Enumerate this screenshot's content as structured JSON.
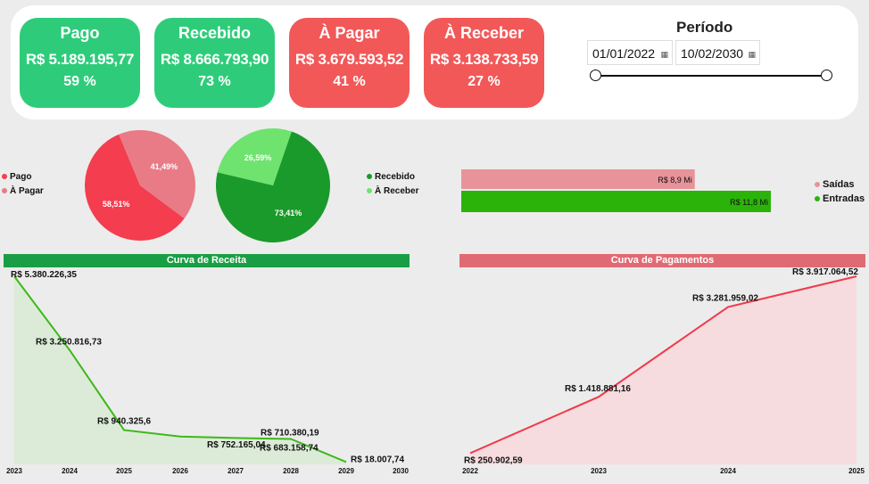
{
  "cards": [
    {
      "title": "Pago",
      "value": "R$ 5.189.195,77",
      "pct": "59 %",
      "color": "#2ecc7a"
    },
    {
      "title": "Recebido",
      "value": "R$ 8.666.793,90",
      "pct": "73 %",
      "color": "#2ecc7a"
    },
    {
      "title": "À Pagar",
      "value": "R$ 3.679.593,52",
      "pct": "41 %",
      "color": "#f25858"
    },
    {
      "title": "À Receber",
      "value": "R$ 3.138.733,59",
      "pct": "27 %",
      "color": "#f25858"
    }
  ],
  "periodo": {
    "title": "Período",
    "start": "01/01/2022",
    "end": "10/02/2030",
    "cal_icon": "calendar-icon"
  },
  "chart_data": [
    {
      "type": "pie",
      "slices": [
        {
          "label": "Pago",
          "value": 58.51,
          "text": "58,51%",
          "color": "#f43d4e"
        },
        {
          "label": "À Pagar",
          "value": 41.49,
          "text": "41,49%",
          "color": "#e87b85"
        }
      ]
    },
    {
      "type": "pie",
      "slices": [
        {
          "label": "Recebido",
          "value": 73.41,
          "text": "73,41%",
          "color": "#1a9a2a"
        },
        {
          "label": "À Receber",
          "value": 26.59,
          "text": "26,59%",
          "color": "#6ee36e"
        }
      ]
    },
    {
      "type": "bar",
      "orientation": "horizontal",
      "series": [
        {
          "name": "Saídas",
          "value": 8.9,
          "text": "R$ 8,9 Mi",
          "color": "#e8939a"
        },
        {
          "name": "Entradas",
          "value": 11.8,
          "text": "R$ 11,8 Mi",
          "color": "#2bb30a"
        }
      ]
    },
    {
      "type": "area",
      "title": "Curva de Receita",
      "header_color": "#1a9e45",
      "line_color": "#3db81a",
      "fill_color": "#dcebd7",
      "x": [
        "2023",
        "2024",
        "2025",
        "2026",
        "2027",
        "2028",
        "2029",
        "2030"
      ],
      "values": [
        5380226.35,
        3250816.73,
        940325.6,
        752165.04,
        710380.19,
        683158.74,
        18007.74,
        null
      ],
      "labels": [
        "R$ 5.380.226,35",
        "R$ 3.250.816,73",
        "R$ 940.325,6",
        "R$ 752.165,04",
        "R$ 710.380,19",
        "R$ 683.158,74",
        "R$ 18.007,74",
        ""
      ]
    },
    {
      "type": "area",
      "title": "Curva de Pagamentos",
      "header_color": "#e06a73",
      "line_color": "#f03a4a",
      "fill_color": "#f6dcdf",
      "x": [
        "2022",
        "2023",
        "2024",
        "2025"
      ],
      "values": [
        250902.59,
        1418881.16,
        3281959.02,
        3917064.52
      ],
      "labels": [
        "R$ 250.902,59",
        "R$ 1.418.881,16",
        "R$ 3.281.959,02",
        "R$ 3.917.064,52"
      ]
    }
  ]
}
